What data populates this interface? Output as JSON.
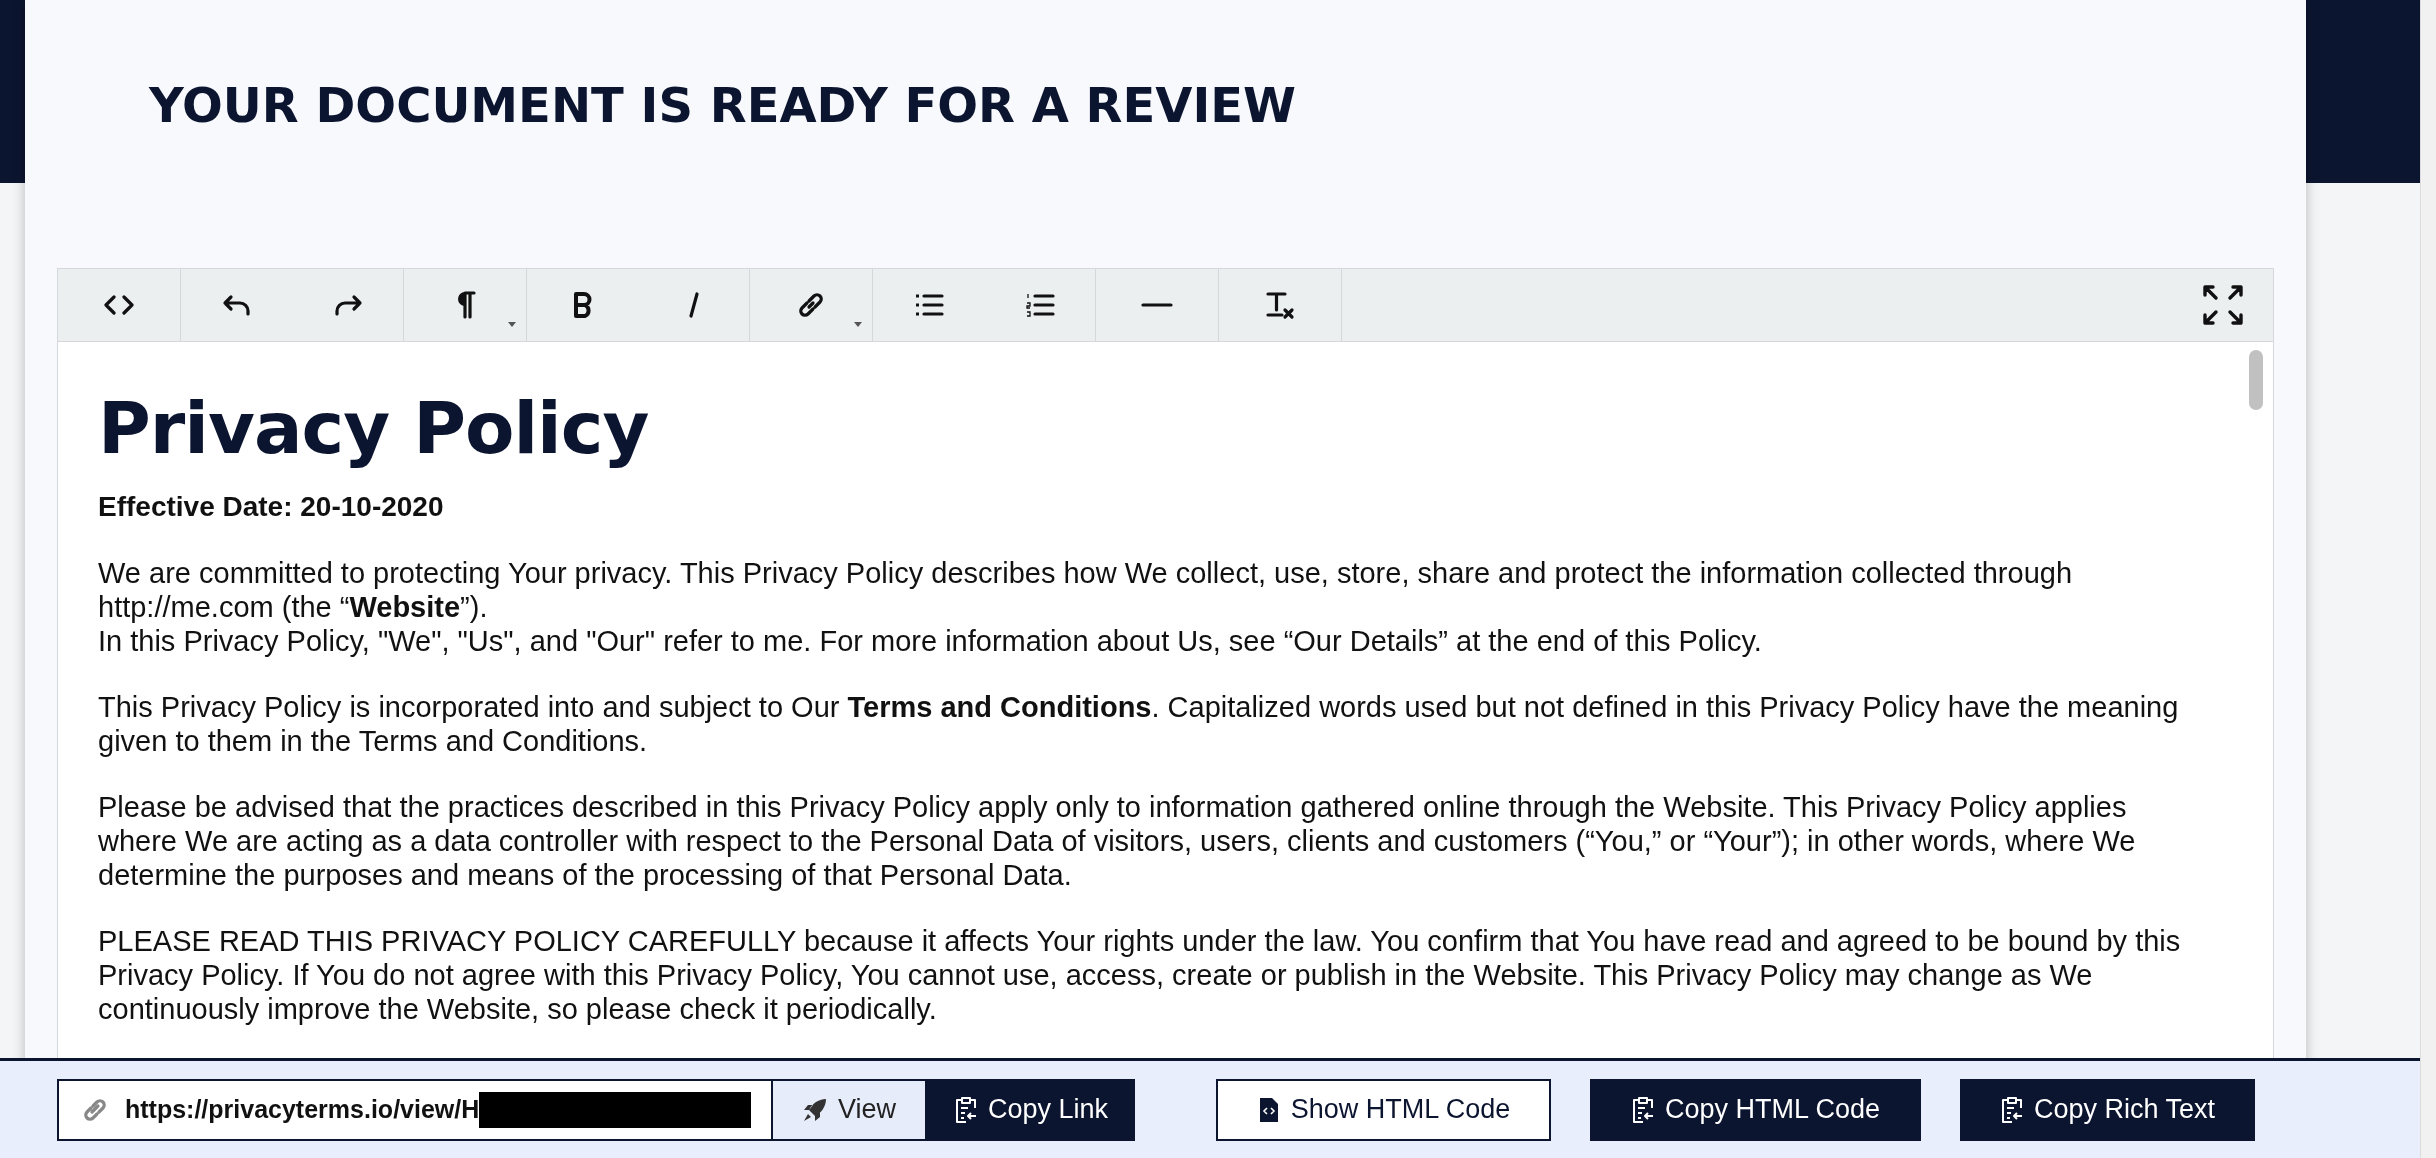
{
  "heading": "YOUR DOCUMENT IS READY FOR A REVIEW",
  "toolbar": {
    "groups": [
      {
        "buttons": [
          {
            "kind": "code"
          }
        ]
      },
      {
        "buttons": [
          {
            "kind": "undo"
          },
          {
            "kind": "redo"
          }
        ]
      },
      {
        "buttons": [
          {
            "kind": "paragraph",
            "dropdown": true
          }
        ]
      },
      {
        "buttons": [
          {
            "kind": "bold"
          },
          {
            "kind": "italic"
          }
        ]
      },
      {
        "buttons": [
          {
            "kind": "link",
            "dropdown": true
          }
        ]
      },
      {
        "buttons": [
          {
            "kind": "bullets"
          },
          {
            "kind": "numbers"
          }
        ]
      },
      {
        "buttons": [
          {
            "kind": "rule"
          }
        ]
      },
      {
        "buttons": [
          {
            "kind": "clear"
          }
        ]
      }
    ],
    "fullscreen": true
  },
  "document": {
    "title": "Privacy Policy",
    "effective_date": "Effective Date: 20-10-2020",
    "paragraphs": [
      [
        "We are committed to protecting Your privacy. This Privacy Policy describes how We collect, use, store, share and protect the information collected through http://me.com (the “**Website**”).",
        "In this Privacy Policy, \"We\", \"Us\", and \"Our\" refer to me. For more information about Us, see “Our Details” at the end of this Policy."
      ],
      [
        "This Privacy Policy is incorporated into and subject to Our **Terms and Conditions**. Capitalized words used but not defined in this Privacy Policy have the meaning given to them in the Terms and Conditions."
      ],
      [
        "Please be advised that the practices described in this Privacy Policy apply only to information gathered online through the Website. This Privacy Policy applies where We are acting as a data controller with respect to the Personal Data of visitors, users, clients and customers (“You,” or “Your”); in other words, where We determine the purposes and means of the processing of that Personal Data."
      ],
      [
        "PLEASE READ THIS PRIVACY POLICY CAREFULLY because it affects Your rights under the law. You confirm that You have read and agreed to be bound by this Privacy Policy. If You do not agree with this Privacy Policy, You cannot use, access, create or publish in the Website. This Privacy Policy may change as We continuously improve the Website, so please check it periodically."
      ]
    ]
  },
  "share_bar": {
    "link": "https://privacyterms.io/view/H",
    "redacted": true,
    "link_buttons": [
      {
        "label": "View",
        "kind": "light"
      },
      {
        "label": "Copy Link",
        "kind": "dark"
      }
    ],
    "buttons": [
      {
        "label": "Show HTML Code",
        "kind": "outline"
      },
      {
        "label": "Copy HTML Code",
        "kind": "dark"
      },
      {
        "label": "Copy Rich Text",
        "kind": "dark"
      }
    ]
  }
}
